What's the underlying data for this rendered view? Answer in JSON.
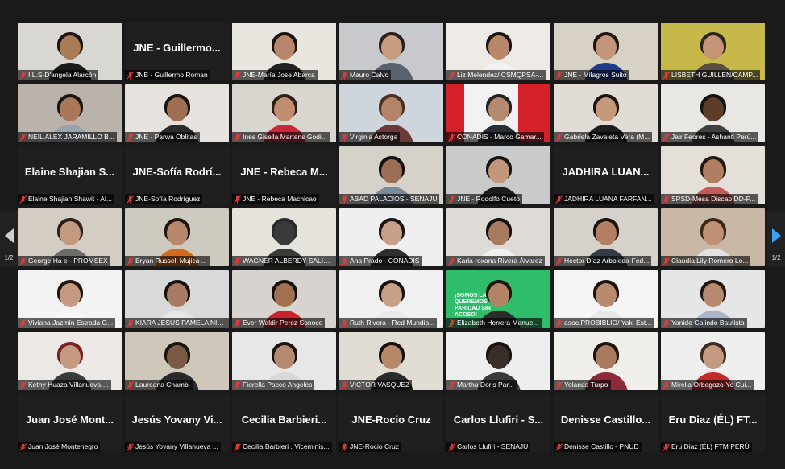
{
  "pager": {
    "left_page": "1/2",
    "right_page": "1/2"
  },
  "colors": {
    "active_border": "#b5d84a",
    "pager_arrow_active": "#39a3ef",
    "muted_mic": "#e23b3b"
  },
  "tiles": [
    {
      "name": "I.L.S-D'angela  Alarcón",
      "big": "",
      "bg": "#d9d7d2",
      "skin": "#a87a58",
      "hair": "#1c1410",
      "shirt": "#1a1a1a"
    },
    {
      "name": "JNE - Guillermo Roman",
      "big": "JNE - Guillermo...",
      "bg": "",
      "skin": "",
      "hair": "",
      "shirt": ""
    },
    {
      "name": "JNE-María Jose Abarca",
      "big": "",
      "bg": "#e9e6e0",
      "skin": "#b8866a",
      "hair": "#1a1310",
      "shirt": "#222222",
      "active": true
    },
    {
      "name": "Mauro Calvo",
      "big": "",
      "bg": "#c8c9cc",
      "skin": "#c79c80",
      "hair": "#2a1e18",
      "shirt": "#5a6270"
    },
    {
      "name": "Liz Melendez/ CSMQPSA-...",
      "big": "",
      "bg": "#eeeae6",
      "skin": "#b8886b",
      "hair": "#1d1511",
      "shirt": "#f2f2f2"
    },
    {
      "name": "JNE - Milagros Suito",
      "big": "",
      "bg": "#d8d1c6",
      "skin": "#c3957a",
      "hair": "#1f1712",
      "shirt": "#1e3c8a"
    },
    {
      "name": "LISBETH GUILLEN/CAMP...",
      "big": "",
      "bg": "#c7b84a",
      "skin": "#c59477",
      "hair": "#2b2420",
      "shirt": "#5b4e3f"
    },
    {
      "name": "NEIL ALEX JARAMILLO B...",
      "big": "",
      "bg": "#b9b3ab",
      "skin": "#a9775a",
      "hair": "#1c1410",
      "shirt": "#9aa2ac"
    },
    {
      "name": "JNE - Parwa Oblitas",
      "big": "",
      "bg": "#e6e3df",
      "skin": "#9e6f52",
      "hair": "#1a1310",
      "shirt": "#2b2b2b"
    },
    {
      "name": "Ines Gisella Martens Godi...",
      "big": "",
      "bg": "#d9d5cf",
      "skin": "#c08d70",
      "hair": "#2b1e16",
      "shirt": "#c8283a"
    },
    {
      "name": "Virginia Astorga",
      "big": "",
      "bg": "#cfd5dc",
      "skin": "#b48468",
      "hair": "#4a3020",
      "shirt": "#6a3a3a"
    },
    {
      "name": "CONADIS - Marco Gamar...",
      "big": "",
      "bg": "#f2f2f2",
      "skin": "#b58a70",
      "hair": "#222222",
      "shirt": "#2a2d35",
      "flag": true
    },
    {
      "name": "Gabriela Zavaleta Vera (M...",
      "big": "",
      "bg": "#e1dcd6",
      "skin": "#c49879",
      "hair": "#1b1411",
      "shirt": "#1f1f1f"
    },
    {
      "name": "Jair Feores - Ashanti Perú...",
      "big": "",
      "bg": "#e8e7e4",
      "skin": "#5d3c2a",
      "hair": "#111111",
      "shirt": "#404040"
    },
    {
      "name": "Elaine Shajian Shawit - Al...",
      "big": "Elaine Shajian S...",
      "bg": "",
      "skin": "",
      "hair": "",
      "shirt": ""
    },
    {
      "name": "JNE-Sofía Rodríguez",
      "big": "JNE-Sofía Rodrí...",
      "bg": "",
      "skin": "",
      "hair": "",
      "shirt": ""
    },
    {
      "name": "JNE - Rebeca Machicao",
      "big": "JNE - Rebeca M...",
      "bg": "",
      "skin": "",
      "hair": "",
      "shirt": ""
    },
    {
      "name": "ABAD PALACIOS - SENAJU",
      "big": "",
      "bg": "#d7d2c9",
      "skin": "#9b6f55",
      "hair": "#151010",
      "shirt": "#7c8a98"
    },
    {
      "name": "JNE - Rodolfo Cueto",
      "big": "",
      "bg": "#c9cacc",
      "skin": "#c2967a",
      "hair": "#1a1410",
      "shirt": "#1c1c1c"
    },
    {
      "name": "JADHIRA LUANA FARFAN...",
      "big": "JADHIRA LUAN...",
      "bg": "",
      "skin": "",
      "hair": "",
      "shirt": ""
    },
    {
      "name": "SPSD-Mesa Discap DD-P...",
      "big": "",
      "bg": "#e4dfd9",
      "skin": "#b07e62",
      "hair": "#241813",
      "shirt": "#c45a5a"
    },
    {
      "name": "George Ha e - PROMSEX",
      "big": "",
      "bg": "#d4cdc4",
      "skin": "#c49a7e",
      "hair": "#2a211b",
      "shirt": "#6b6b6b"
    },
    {
      "name": "Bryan Russell Mujica ...",
      "big": "",
      "bg": "#cfcabf",
      "skin": "#b9876b",
      "hair": "#1c1410",
      "shirt": "#d36a1e"
    },
    {
      "name": "WAGNER ALBERDY SALIN...",
      "big": "",
      "bg": "#e6e3dc",
      "skin": "#3a3a3a",
      "hair": "#2a2a2a",
      "shirt": "#3a3a3a"
    },
    {
      "name": "Ana Prado - CONADIS",
      "big": "",
      "bg": "#efefef",
      "skin": "#c8a08a",
      "hair": "#1b1411",
      "shirt": "#2e2e2e"
    },
    {
      "name": "Karla roxana Rivera Álvarez",
      "big": "",
      "bg": "#dedbd6",
      "skin": "#a77b60",
      "hair": "#130e0b",
      "shirt": "#f0f0f0"
    },
    {
      "name": "Hector Díaz Arboleda-Fed...",
      "big": "",
      "bg": "#d6d2cb",
      "skin": "#b27f63",
      "hair": "#191310",
      "shirt": "#353b46"
    },
    {
      "name": "Claudia Lily Romero Lo...",
      "big": "",
      "bg": "#c9b8a6",
      "skin": "#c09074",
      "hair": "#3a261a",
      "shirt": "#e2e2e2"
    },
    {
      "name": "Viviana Jazmín Estrada G...",
      "big": "",
      "bg": "#f3f3f3",
      "skin": "#c59a80",
      "hair": "#1f1511",
      "shirt": "#f7f7f7"
    },
    {
      "name": "KIARA JESUS PAMELA NILUP...",
      "big": "",
      "bg": "#d9d9d9",
      "skin": "#a77b63",
      "hair": "#151010",
      "shirt": "#e6e6e6"
    },
    {
      "name": "Ever Waldir Perez Sonoco",
      "big": "",
      "bg": "#d7d4cf",
      "skin": "#a1704f",
      "hair": "#151010",
      "shirt": "#c8222a"
    },
    {
      "name": "Ruth Rivera - Red Mundia...",
      "big": "",
      "bg": "#f1f1f1",
      "skin": "#c7a088",
      "hair": "#17110e",
      "shirt": "#e9e9e9"
    },
    {
      "name": "Elizabeth Herrera Manue...",
      "big": "",
      "bg": "",
      "skin": "#b28466",
      "hair": "#1a1310",
      "shirt": "#2c2c2c",
      "banner": true
    },
    {
      "name": "asoc.PROBIBLIO/ Yaki Est...",
      "big": "",
      "bg": "#f4f4f4",
      "skin": "#b88a6e",
      "hair": "#191310",
      "shirt": "#e6e6e6"
    },
    {
      "name": "Yanide Galindo Bautista",
      "big": "",
      "bg": "#e6e6e6",
      "skin": "#b58a6f",
      "hair": "#1f1511",
      "shirt": "#a9b6c9"
    },
    {
      "name": "Kethy Huaza Villanueva-...",
      "big": "",
      "bg": "#ebe8e6",
      "skin": "#c59a80",
      "hair": "#7a1f24",
      "shirt": "#3a3a3a"
    },
    {
      "name": "Laureana Chambi",
      "big": "",
      "bg": "#cfc7ba",
      "skin": "#7a5a45",
      "hair": "#1a1410",
      "shirt": "#2a2a2a"
    },
    {
      "name": "Fiorella Pacco Angeles",
      "big": "",
      "bg": "#e7e7e7",
      "skin": "#b48a72",
      "hair": "#1a1410",
      "shirt": "#d8d8d8"
    },
    {
      "name": "VICTOR VASQUEZ",
      "big": "",
      "bg": "#e1dcd4",
      "skin": "#b7876a",
      "hair": "#161110",
      "shirt": "#2a2a2a"
    },
    {
      "name": "Martha Doris Par...",
      "big": "",
      "bg": "#eeeeee",
      "skin": "#3a2e28",
      "hair": "#1a1410",
      "shirt": "#3a3a3a"
    },
    {
      "name": "Yolanda Turpo",
      "big": "",
      "bg": "#f0efe9",
      "skin": "#a87b5e",
      "hair": "#1a1410",
      "shirt": "#8c2a3a"
    },
    {
      "name": "Mirella Orbegozo-Yo Cui...",
      "big": "",
      "bg": "#efefef",
      "skin": "#c49a80",
      "hair": "#3a2a20",
      "shirt": "#c42a2a"
    },
    {
      "name": "Juan José Montenegro",
      "big": "Juan José Mont...",
      "bg": "",
      "skin": "",
      "hair": "",
      "shirt": ""
    },
    {
      "name": "Jesús Yovany Villanueva ...",
      "big": "Jesús Yovany Vi...",
      "bg": "",
      "skin": "",
      "hair": "",
      "shirt": ""
    },
    {
      "name": "Cecilia Barbieri . Viceminis...",
      "big": "Cecilia Barbieri...",
      "bg": "",
      "skin": "",
      "hair": "",
      "shirt": ""
    },
    {
      "name": "JNE-Rocio Cruz",
      "big": "JNE-Rocio Cruz",
      "bg": "",
      "skin": "",
      "hair": "",
      "shirt": ""
    },
    {
      "name": "Carlos Llufiri - SENAJU",
      "big": "Carlos Llufiri - S...",
      "bg": "",
      "skin": "",
      "hair": "",
      "shirt": ""
    },
    {
      "name": "Denisse Castillo - PNUD",
      "big": "Denisse Castillo...",
      "bg": "",
      "skin": "",
      "hair": "",
      "shirt": ""
    },
    {
      "name": "Eru Diaz (ÉL) FTM PERÚ",
      "big": "Eru Diaz (ÉL) FT...",
      "bg": "",
      "skin": "",
      "hair": "",
      "shirt": ""
    }
  ],
  "banner": {
    "text": "¡SOMOS LA MITAD, QUEREMOS PARIDAD SIN ACOSO!"
  }
}
